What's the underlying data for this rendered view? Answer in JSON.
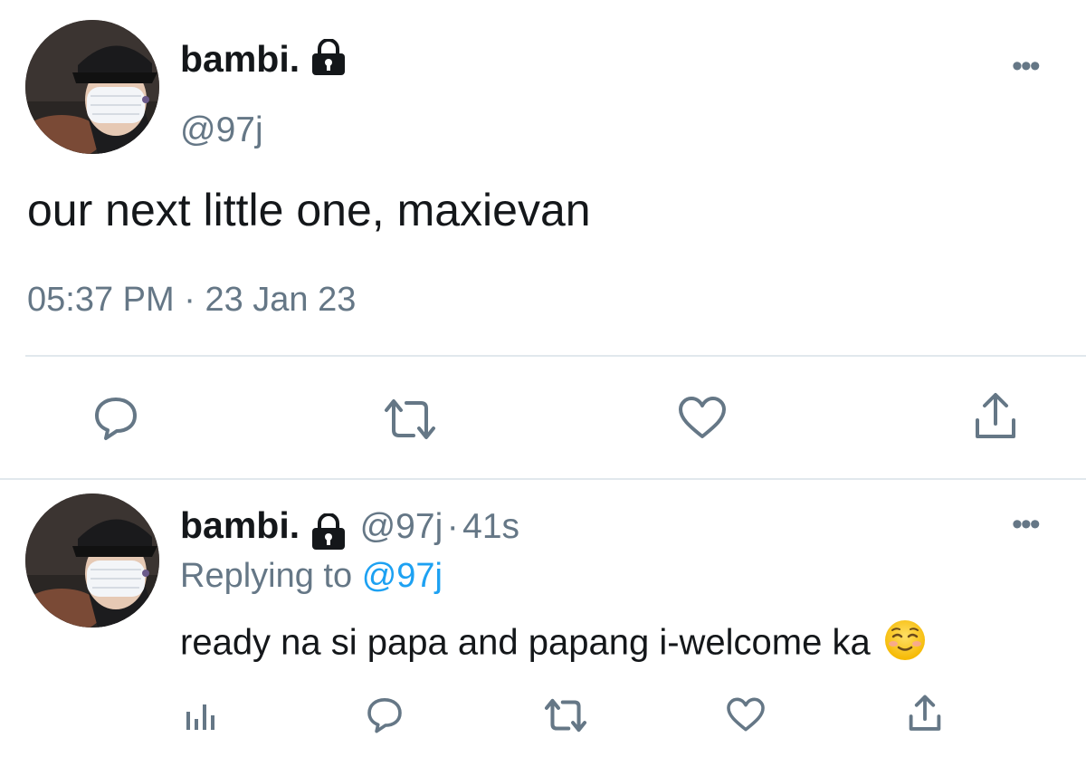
{
  "tweet": {
    "display_name": "bambi.",
    "handle": "@97j",
    "text": "our next little one, maxievan",
    "time": "05:37 PM",
    "separator": "·",
    "date": "23 Jan 23",
    "more_label": "•••",
    "icons": [
      "lock-icon",
      "reply-icon",
      "retweet-icon",
      "like-icon",
      "share-icon",
      "more-icon"
    ]
  },
  "reply": {
    "display_name": "bambi.",
    "handle": "@97j",
    "separator": "·",
    "age": "41s",
    "replying_prefix": "Replying to",
    "replying_mention": "@97j",
    "text": "ready na si papa and papang i-welcome ka",
    "emoji": "relieved-smiling-face-emoji",
    "more_label": "•••",
    "icons": [
      "analytics-icon",
      "reply-icon",
      "retweet-icon",
      "like-icon",
      "share-icon"
    ]
  },
  "colors": {
    "text_primary": "#14171a",
    "text_secondary": "#657786",
    "link": "#1da1f2",
    "divider": "#e1e8ed",
    "background": "#ffffff"
  }
}
